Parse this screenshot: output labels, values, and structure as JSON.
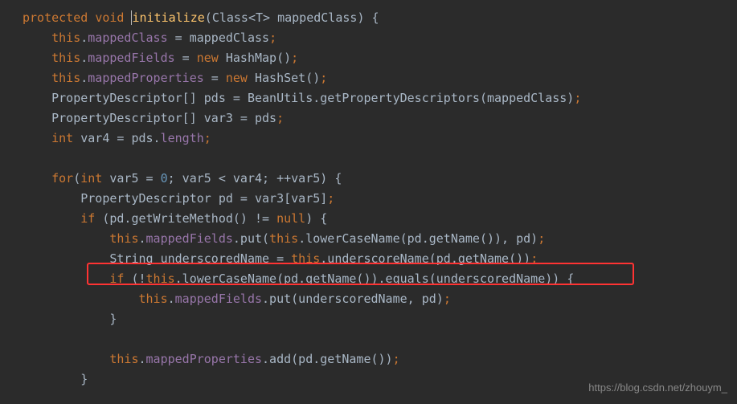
{
  "code": {
    "line1": {
      "protected": "protected",
      "void": "void",
      "method": "initialize",
      "paramType1": "Class",
      "generic": "<T>",
      "paramName": "mappedClass",
      "brace": ") {"
    },
    "line2": {
      "this": "this",
      "field": "mappedClass",
      "assign": " = mappedClass",
      "semi": ";"
    },
    "line3": {
      "this": "this",
      "field": "mappedFields",
      "assign": " = ",
      "new": "new",
      "type": " HashMap()",
      "semi": ";"
    },
    "line4": {
      "this": "this",
      "field": "mappedProperties",
      "assign": " = ",
      "new": "new",
      "type": " HashSet()",
      "semi": ";"
    },
    "line5": {
      "decl": "PropertyDescriptor[] pds = BeanUtils.getPropertyDescriptors(mappedClass)",
      "semi": ";"
    },
    "line6": {
      "decl": "PropertyDescriptor[] var3 = pds",
      "semi": ";"
    },
    "line7": {
      "int": "int",
      "decl": " var4 = pds.",
      "length": "length",
      "semi": ";"
    },
    "line9": {
      "for": "for",
      "open": "(",
      "int": "int",
      "init": " var5 = ",
      "zero": "0",
      "cond": "; var5 < var4; ++var5) {"
    },
    "line10": {
      "decl": "PropertyDescriptor pd = var3[var5]",
      "semi": ";"
    },
    "line11": {
      "if": "if",
      "cond": " (pd.getWriteMethod() != ",
      "null": "null",
      "close": ") {"
    },
    "line12": {
      "this": "this",
      "field": "mappedFields",
      "call": ".put(",
      "this2": "this",
      "method": ".lowerCaseName(pd.getName()), pd)",
      "semi": ";"
    },
    "line13": {
      "type": "String underscoredName = ",
      "this": "this",
      "method": ".underscoreName(pd.getName())",
      "semi": ";"
    },
    "line14": {
      "if": "if",
      "open": " (!",
      "this": "this",
      "method": ".lowerCaseName(pd.getName()).equals(underscoredName)) {"
    },
    "line15": {
      "this": "this",
      "field": "mappedFields",
      "call": ".put(underscoredName, pd)",
      "semi": ";"
    },
    "line16": {
      "brace": "}"
    },
    "line18": {
      "this": "this",
      "field": "mappedProperties",
      "call": ".add(pd.getName())",
      "semi": ";"
    },
    "line19": {
      "brace": "}"
    }
  },
  "watermark": "https://blog.csdn.net/zhouym_"
}
